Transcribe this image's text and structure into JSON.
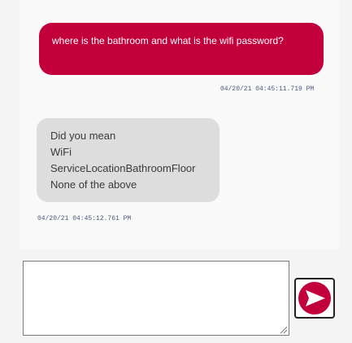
{
  "messages": {
    "user": {
      "text": "where is the bathroom and what is the wifi password?",
      "timestamp": "04/20/21 04:45:11.719 PM"
    },
    "bot": {
      "options": [
        "Did you mean",
        "WiFi",
        "ServiceLocationBathroomFloor",
        "None of the above"
      ],
      "timestamp": "04/20/21 04:45:12.761 PM"
    }
  },
  "composer": {
    "value": "",
    "placeholder": ""
  },
  "send": {
    "icon": "send-arrow-icon"
  },
  "colors": {
    "accent": "#c2003c",
    "bot_bubble": "#dddddd",
    "timestamp": "#4a5a7a"
  }
}
